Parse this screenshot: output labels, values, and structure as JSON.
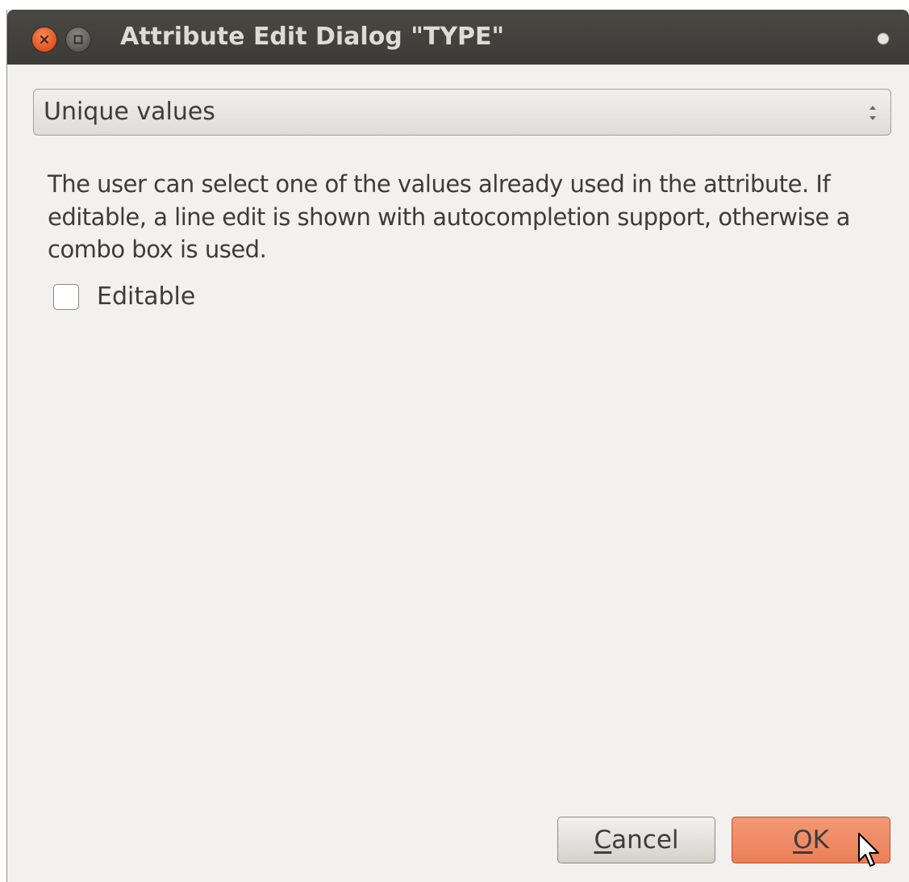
{
  "window": {
    "title": "Attribute Edit Dialog \"TYPE\"",
    "close_icon": "close-icon",
    "maximize_icon": "maximize-icon",
    "menu_indicator_icon": "title-dot-icon"
  },
  "widget_type": {
    "selected": "Unique values",
    "arrows_icon": "spinner-arrows-icon"
  },
  "description": "The user can select one of the values already used in the attribute. If editable, a line edit is shown with autocompletion support, otherwise a combo box is used.",
  "editable": {
    "label": "Editable",
    "checked": false
  },
  "buttons": {
    "cancel": {
      "mnemonic": "C",
      "rest": "ancel"
    },
    "ok": {
      "mnemonic": "O",
      "rest": "K"
    }
  },
  "colors": {
    "titlebar": "#3c3b37",
    "dialog_bg": "#f2f1f0",
    "ok_accent": "#ea7f58",
    "close_button": "#e0531f"
  }
}
